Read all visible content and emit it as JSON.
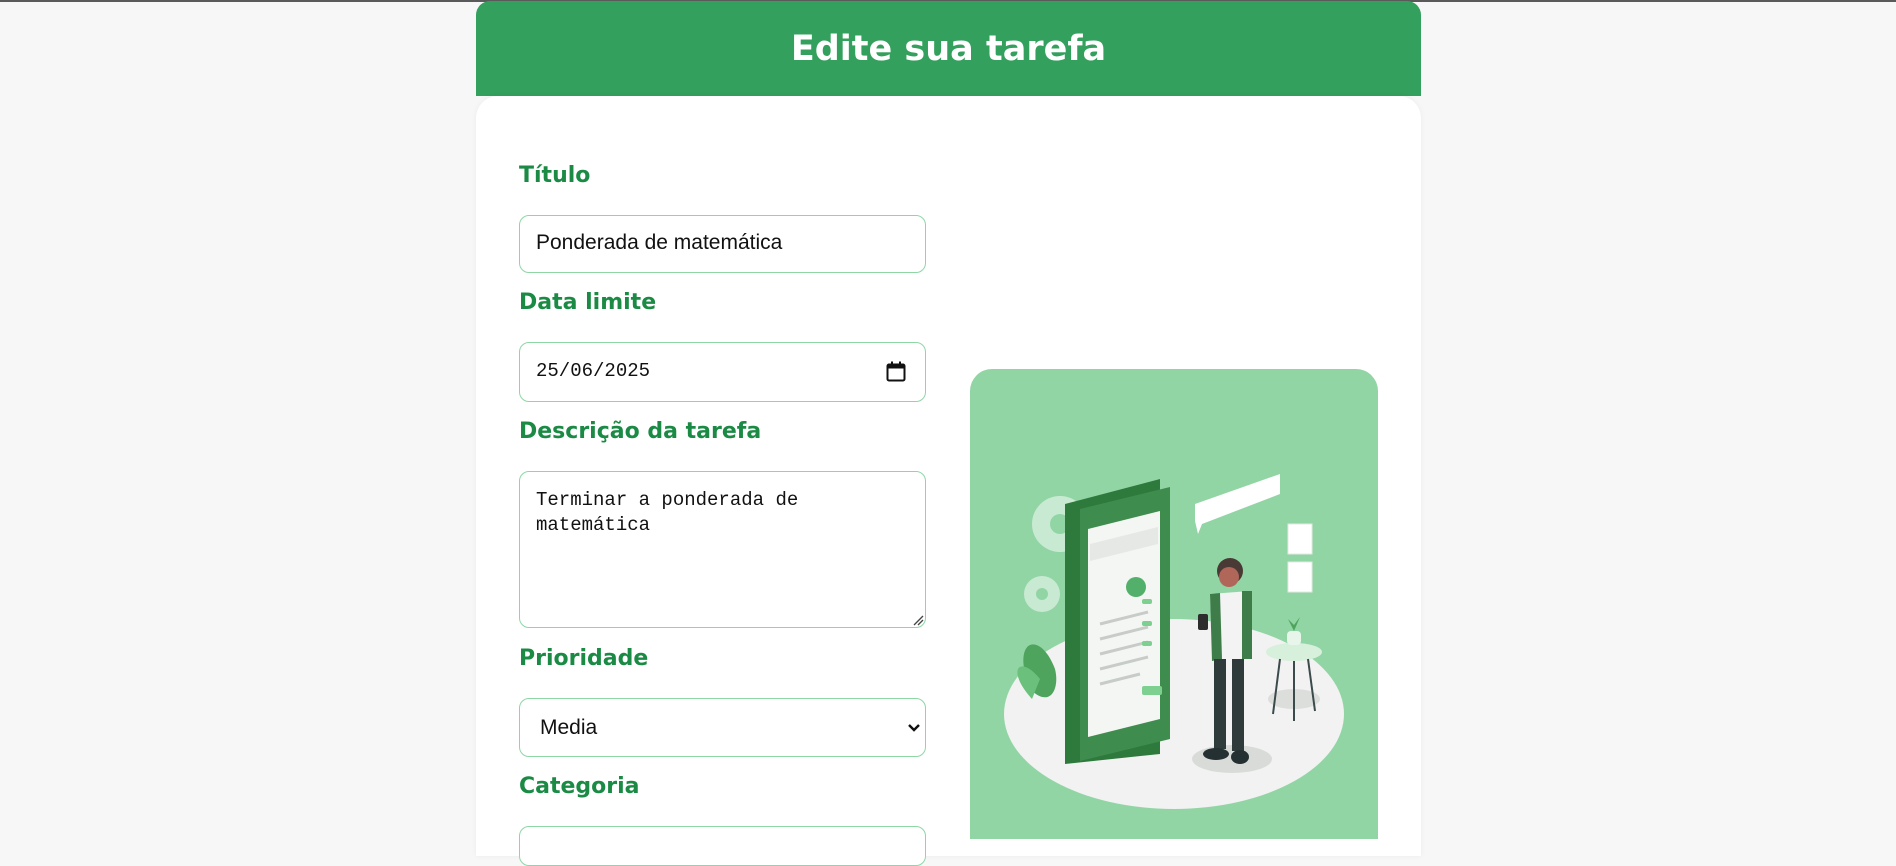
{
  "page": {
    "title": "Edite sua tarefa"
  },
  "form": {
    "titulo": {
      "label": "Título",
      "value": "Ponderada de matemática"
    },
    "data_limite": {
      "label": "Data limite",
      "value": "25/06/2025"
    },
    "descricao": {
      "label": "Descrição da tarefa",
      "value": "Terminar a ponderada de",
      "value_line2": "matemática"
    },
    "prioridade": {
      "label": "Prioridade",
      "value": "Media"
    },
    "categoria": {
      "label": "Categoria"
    }
  },
  "colors": {
    "header_green": "#34a05d",
    "label_green": "#1b8a45",
    "field_border": "#8fd6a6",
    "illustration_bg": "#92d5a5"
  },
  "icons": [
    "calendar-icon",
    "chevron-down-icon",
    "resize-handle-icon"
  ]
}
